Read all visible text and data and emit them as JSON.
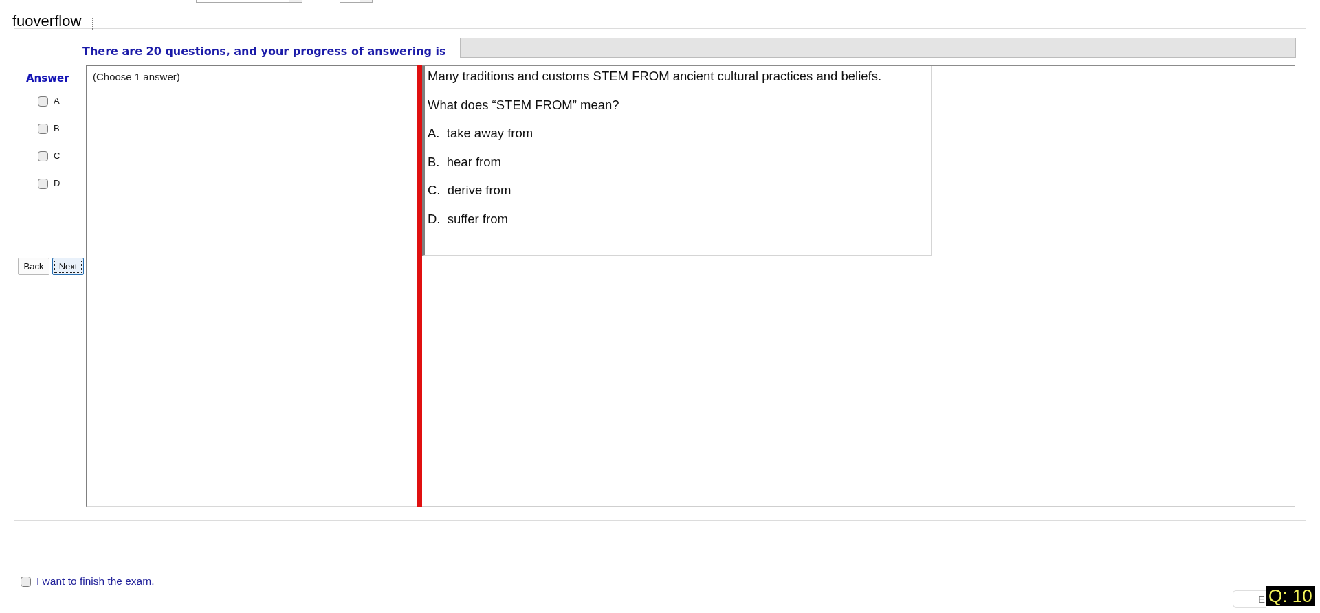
{
  "top_bar": {
    "controls": [
      {
        "kind": "dropdown"
      },
      {
        "kind": "spin"
      }
    ],
    "brand": "fuoverflow"
  },
  "exam": {
    "progress": {
      "label": "There are 20 questions, and your progress of answering is",
      "level": 0
    },
    "answer": {
      "title": "Answer",
      "options": [
        {
          "label": "A",
          "checked": false
        },
        {
          "label": "B",
          "checked": false
        },
        {
          "label": "C",
          "checked": false
        },
        {
          "label": "D",
          "checked": false
        }
      ],
      "hint": "(Choose 1 answer)"
    },
    "nav_buttons": [
      {
        "label": "Back",
        "focused": false
      },
      {
        "label": "Next",
        "focused": true
      }
    ],
    "question": {
      "lines": [
        "Many traditions and customs STEM FROM ancient cultural practices and beliefs.",
        "What does “STEM FROM” mean?",
        "A.  take away from",
        "B.  hear from",
        "C.  derive from",
        "D.  suffer from"
      ]
    }
  },
  "footer": {
    "finish": {
      "label": "I want to finish the exam.",
      "checked": false
    },
    "bottom_control": {
      "text": "E"
    },
    "counter": "Q: 10"
  }
}
